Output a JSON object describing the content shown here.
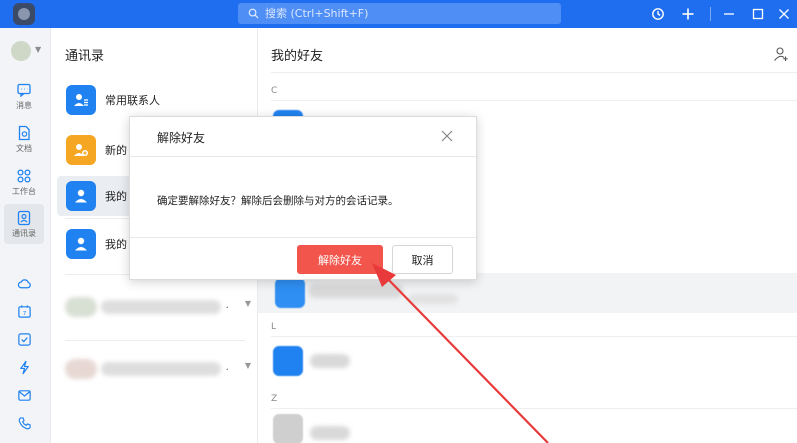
{
  "titlebar": {
    "search_placeholder": "搜索 (Ctrl+Shift+F)",
    "icons": [
      "history-icon",
      "plus-icon",
      "minimize-icon",
      "maximize-icon",
      "close-icon"
    ]
  },
  "nav": {
    "items": [
      {
        "id": "messages",
        "label": "消息",
        "icon": "chat-icon"
      },
      {
        "id": "docs",
        "label": "文档",
        "icon": "document-icon"
      },
      {
        "id": "workbench",
        "label": "工作台",
        "icon": "apps-icon"
      },
      {
        "id": "contacts",
        "label": "通讯录",
        "icon": "contacts-icon",
        "active": true
      }
    ],
    "bottom_icons": [
      "cloud-icon",
      "calendar-icon",
      "task-icon",
      "lightning-icon",
      "mail-icon",
      "phone-icon"
    ]
  },
  "contacts": {
    "title": "通讯录",
    "items": [
      {
        "label": "常用联系人",
        "color": "#1f82f0"
      },
      {
        "label": "新的",
        "color": "#f5a623"
      },
      {
        "label": "我的",
        "color": "#1f82f0",
        "active": true
      },
      {
        "label": "我的",
        "color": "#1f82f0"
      }
    ],
    "group_marks": [
      ".",
      "."
    ]
  },
  "friends": {
    "title": "我的好友",
    "letters": [
      "C",
      "L",
      "Z"
    ]
  },
  "dialog": {
    "title": "解除好友",
    "message": "确定要解除好友？解除后会删除与对方的会话记录。",
    "confirm_label": "解除好友",
    "cancel_label": "取消"
  },
  "colors": {
    "titlebar": "#1f6ef0",
    "primary": "#1f82f0",
    "danger": "#f2554b",
    "annotation": "#e83a3a"
  }
}
